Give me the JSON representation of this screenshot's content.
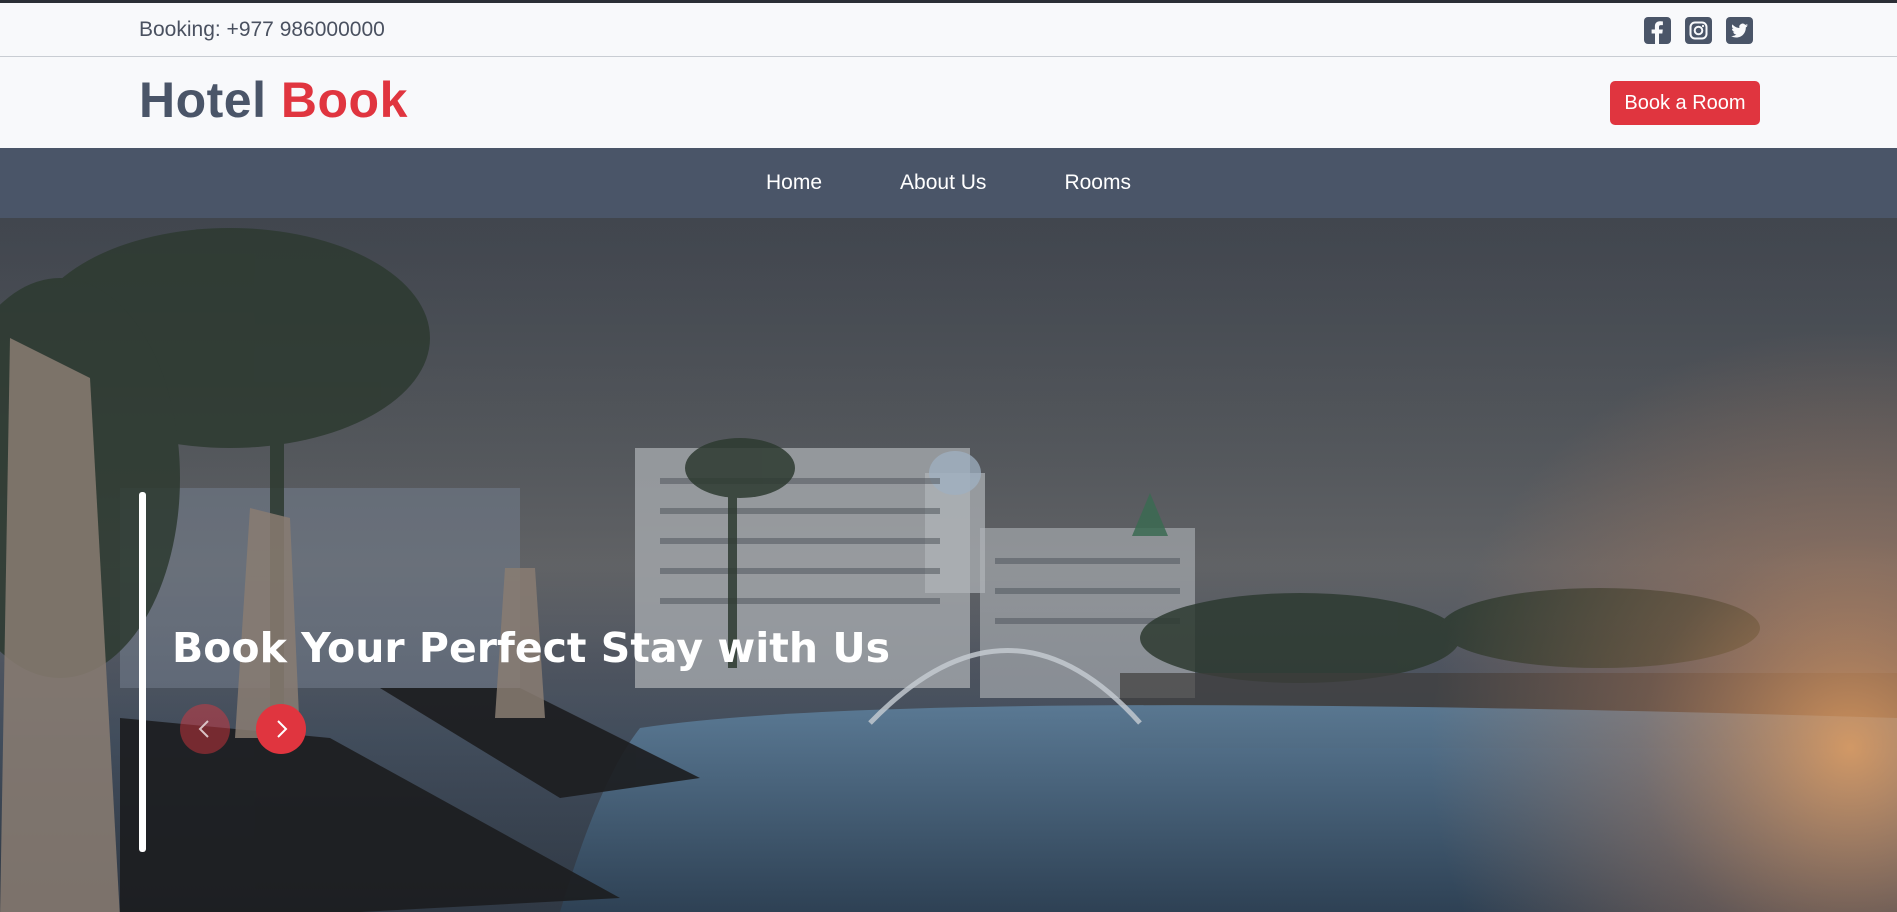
{
  "topbar": {
    "booking_text": "Booking: +977 986000000",
    "social": [
      {
        "icon": "facebook-icon"
      },
      {
        "icon": "instagram-icon"
      },
      {
        "icon": "twitter-icon"
      }
    ]
  },
  "header": {
    "logo_part1": "Hotel",
    "logo_part2": "Book",
    "book_button": "Book a Room"
  },
  "nav": {
    "items": [
      {
        "label": "Home"
      },
      {
        "label": "About Us"
      },
      {
        "label": "Rooms"
      }
    ]
  },
  "hero": {
    "title": "Book Your Perfect Stay with Us",
    "prev_icon": "chevron-left-icon",
    "next_icon": "chevron-right-icon"
  },
  "colors": {
    "accent": "#e0353f",
    "slate": "#4a5568",
    "background": "#f8f9fb"
  }
}
